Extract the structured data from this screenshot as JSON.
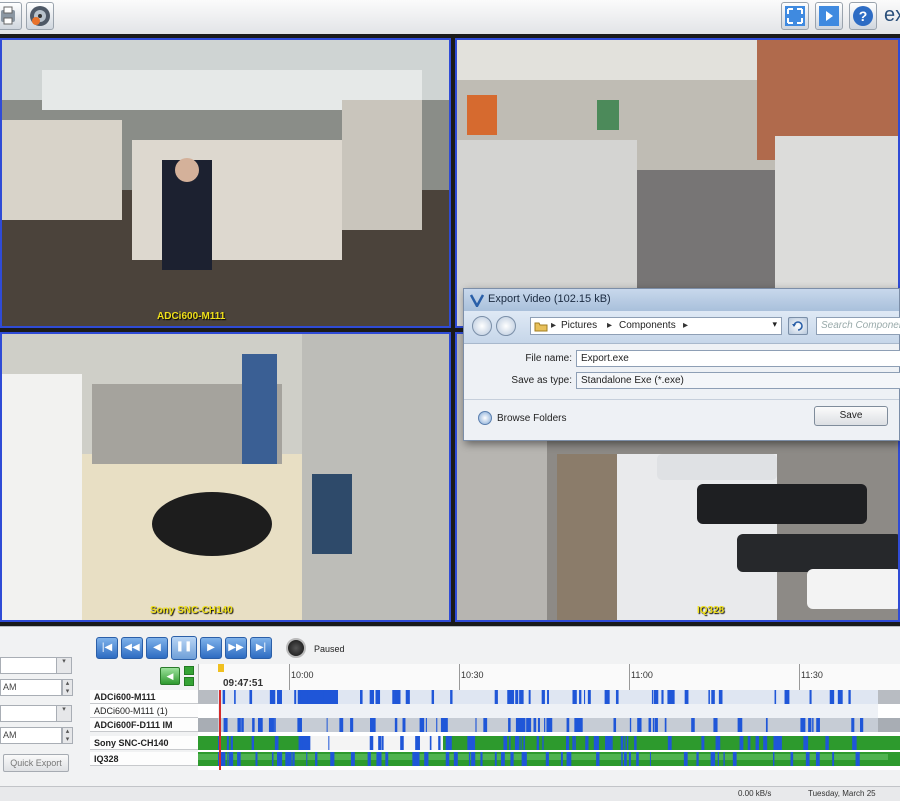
{
  "app": {
    "brand": "ex"
  },
  "cameras": [
    {
      "label": "ADCi600-M111"
    },
    {
      "label": ""
    },
    {
      "label": "Sony SNC-CH140"
    },
    {
      "label": "IQ328"
    }
  ],
  "export_dialog": {
    "title": "Export Video (102.15 kB)",
    "breadcrumb": [
      "Pictures",
      "Components"
    ],
    "search_placeholder": "Search Components",
    "file_name_label": "File name:",
    "file_name_value": "Export.exe",
    "save_as_label": "Save as type:",
    "save_as_value": "Standalone Exe (*.exe)",
    "browse_folders": "Browse Folders",
    "save_button": "Save"
  },
  "playback": {
    "status": "Paused",
    "current_time": "09:47:51",
    "ticks": [
      "10:00",
      "10:30",
      "11:00",
      "11:30"
    ]
  },
  "left_controls": {
    "time1": "AM",
    "time2": "AM",
    "quick_export": "Quick Export"
  },
  "timeline_rows": [
    {
      "label": "ADCi600-M111",
      "bold": true
    },
    {
      "label": "ADCi600-M111 (1)",
      "bold": false
    },
    {
      "label": "ADCi600F-D111 IM",
      "bold": true
    },
    {
      "label": "Sony SNC-CH140",
      "bold": true
    },
    {
      "label": "IQ328",
      "bold": true
    }
  ],
  "status_bar": {
    "rate": "0.00 kB/s",
    "date": "Tuesday, March 25"
  },
  "colors": {
    "camera_border": "#2f4bd6",
    "label_yellow": "#f0e01a",
    "motion_blue": "#1f56d8",
    "recording_green": "#2d9a2d"
  }
}
